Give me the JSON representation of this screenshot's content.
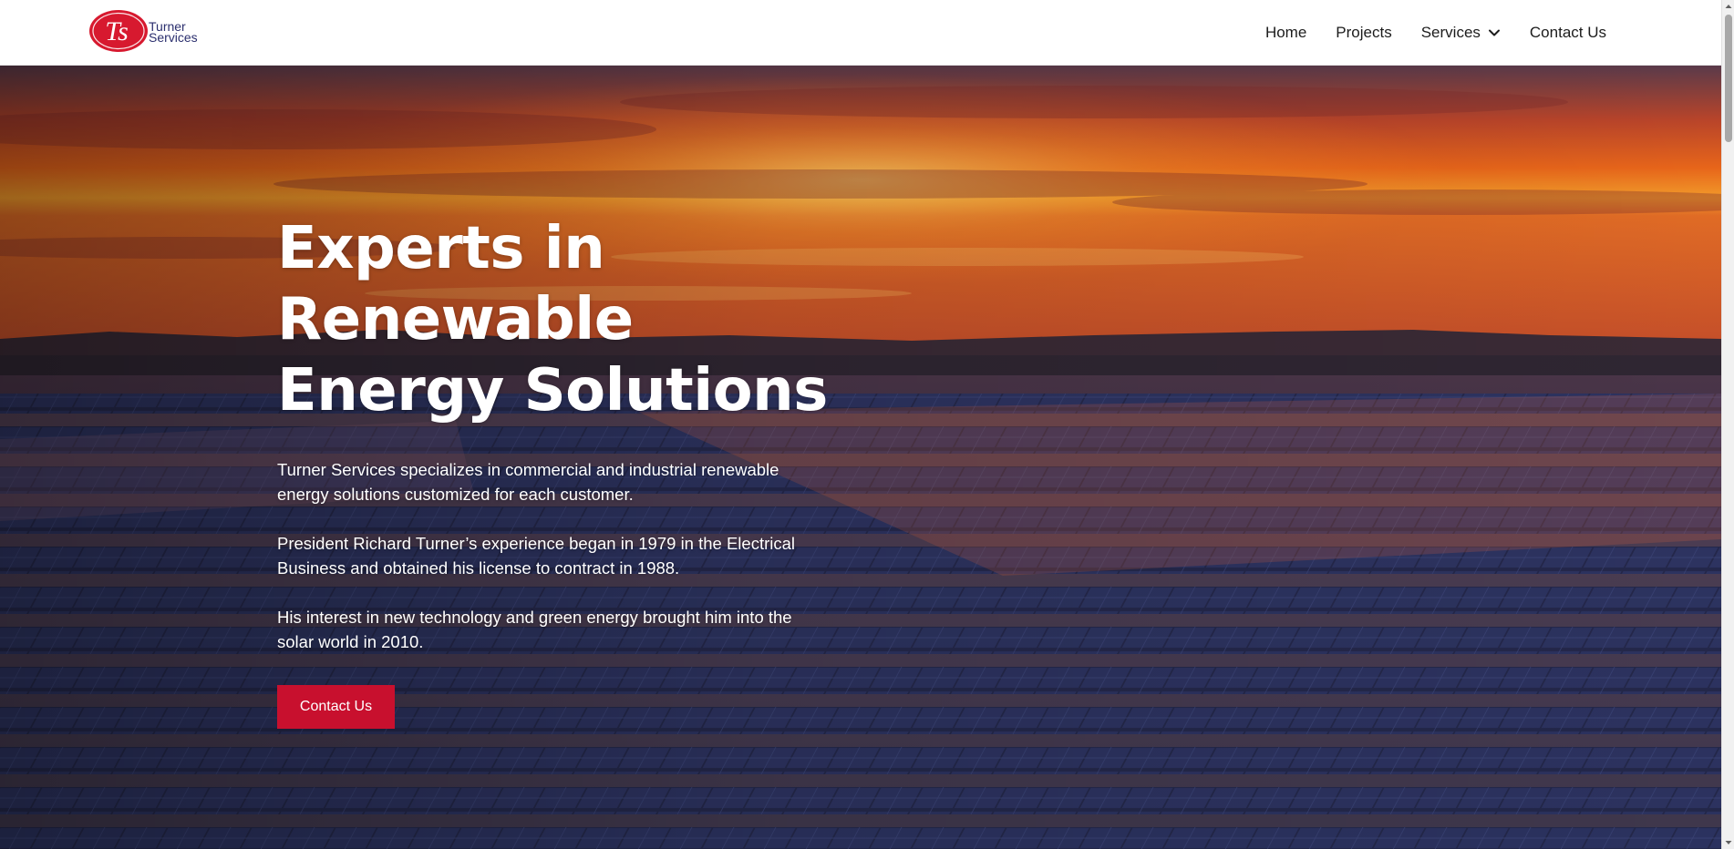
{
  "header": {
    "logo": {
      "monogram": "Ts",
      "line1": "Turner",
      "line2": "Services",
      "colors": {
        "badge": "#d7192f",
        "text": "#2b2f6e"
      }
    },
    "nav": [
      {
        "label": "Home"
      },
      {
        "label": "Projects"
      },
      {
        "label": "Services",
        "icon": "chevron-down-icon"
      },
      {
        "label": "Contact Us"
      }
    ]
  },
  "hero": {
    "title_lines": [
      "Experts in",
      "Renewable",
      "Energy Solutions"
    ],
    "paragraphs": [
      "Turner Services specializes in commercial and industrial renewable energy solutions customized for each customer.",
      "President Richard Turner’s experience began in 1979 in the Electrical Business and obtained his license to contract in 1988.",
      "His interest in new technology and green energy brought him into the solar world in 2010."
    ],
    "cta_label": "Contact Us",
    "accent_color": "#c8102e"
  }
}
